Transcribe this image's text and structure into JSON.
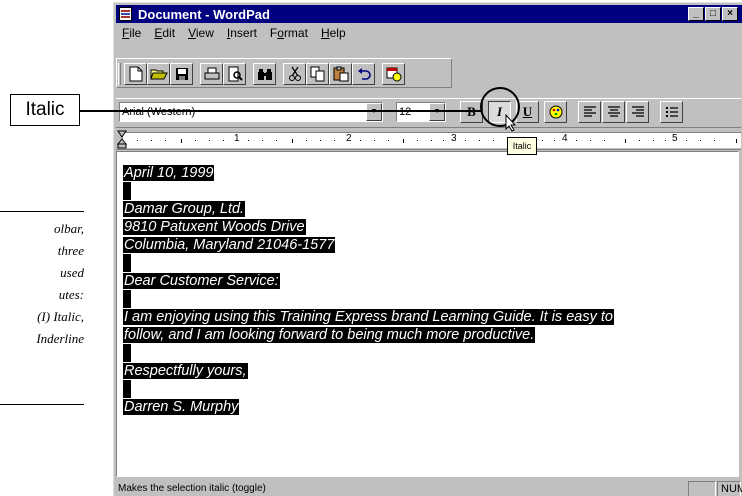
{
  "margin_notes": [
    "olbar,",
    "three",
    "used",
    "utes:",
    "(I)  Italic,",
    "Inderline"
  ],
  "callout": {
    "label": "Italic"
  },
  "window": {
    "title": "Document - WordPad",
    "controls": {
      "minimize": "_",
      "maximize": "□",
      "close": "×"
    }
  },
  "menu": [
    {
      "key": "F",
      "rest": "ile"
    },
    {
      "key": "E",
      "rest": "dit"
    },
    {
      "key": "V",
      "rest": "iew"
    },
    {
      "key": "I",
      "rest": "nsert"
    },
    {
      "pre": "F",
      "key": "o",
      "rest": "rmat"
    },
    {
      "key": "H",
      "rest": "elp"
    }
  ],
  "toolbar": {
    "icons": [
      "new-icon",
      "open-icon",
      "save-icon",
      "print-icon",
      "print-preview-icon",
      "find-icon",
      "cut-icon",
      "copy-icon",
      "paste-icon",
      "undo-icon",
      "date-time-icon"
    ]
  },
  "format_bar": {
    "font_name": "Arial (Western)",
    "font_size": "12",
    "bold": "B",
    "italic": "I",
    "underline": "U"
  },
  "ruler": {
    "numbers": [
      "1",
      "2",
      "3",
      "4",
      "5"
    ]
  },
  "tooltip": "Italic",
  "document": {
    "lines": [
      "April 10, 1999",
      "",
      "Damar Group, Ltd.",
      "9810 Patuxent Woods Drive",
      "Columbia, Maryland  21046-1577",
      "",
      "Dear Customer Service:",
      "",
      "I am enjoying using this Training Express brand Learning Guide.  It is easy to",
      "follow, and I am looking forward to being much more productive.",
      "",
      "Respectfully yours,",
      "",
      "Darren S. Murphy"
    ]
  },
  "status": {
    "text": "Makes the selection italic (toggle)",
    "num": "NUM"
  }
}
